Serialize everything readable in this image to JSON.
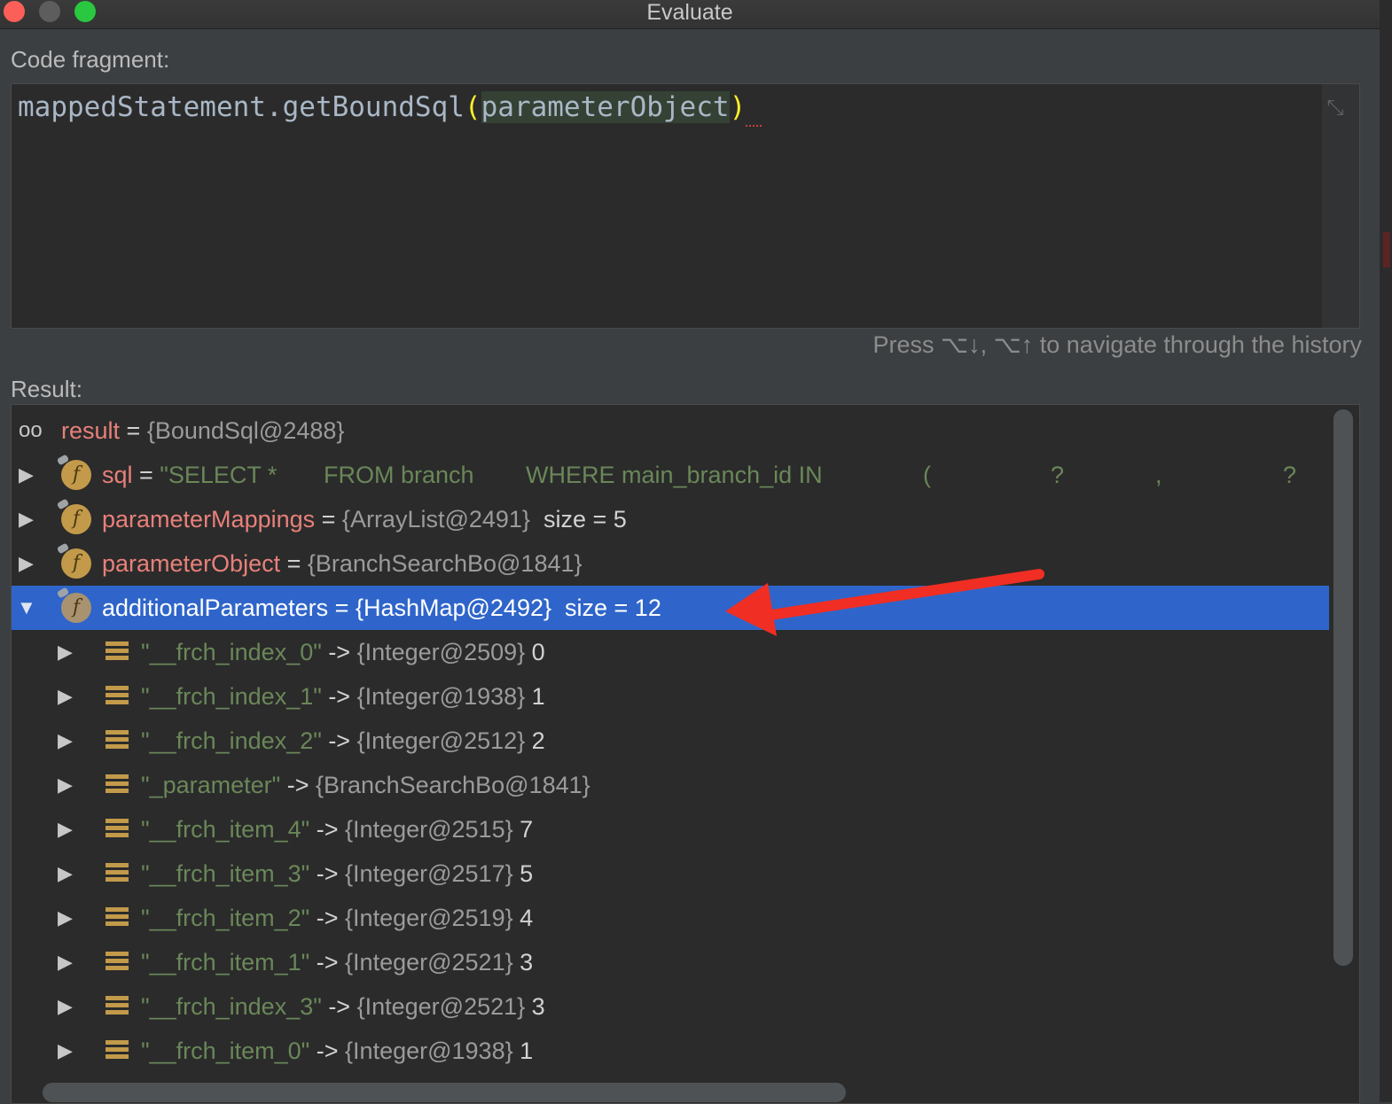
{
  "window": {
    "title": "Evaluate"
  },
  "code_fragment": {
    "label": "Code fragment:",
    "text_method": "mappedStatement.getBoundSql",
    "text_open": "(",
    "text_arg": "parameterObject",
    "text_close": ")"
  },
  "history_hint": "Press ⌥↓, ⌥↑ to navigate through the history",
  "result": {
    "label": "Result:",
    "root": {
      "name": "result",
      "eq": " = ",
      "value": "{BoundSql@2488}"
    },
    "fields": [
      {
        "name": "sql",
        "eq": " = ",
        "value": "\"SELECT *",
        "sql_parts": [
          "FROM branch",
          "WHERE main_branch_id IN",
          "(",
          "?",
          ",",
          "?"
        ]
      },
      {
        "name": "parameterMappings",
        "eq": " = ",
        "value": "{ArrayList@2491}",
        "extra": "size = 5"
      },
      {
        "name": "parameterObject",
        "eq": " = ",
        "value": "{BranchSearchBo@1841}"
      },
      {
        "name": "additionalParameters",
        "eq": " = ",
        "value": "{HashMap@2492}",
        "extra": "size = 12",
        "selected": true
      }
    ],
    "entries": [
      {
        "key": "\"__frch_index_0\"",
        "arrow": " -> ",
        "ref": "{Integer@2509}",
        "val": "0"
      },
      {
        "key": "\"__frch_index_1\"",
        "arrow": " -> ",
        "ref": "{Integer@1938}",
        "val": "1"
      },
      {
        "key": "\"__frch_index_2\"",
        "arrow": " -> ",
        "ref": "{Integer@2512}",
        "val": "2"
      },
      {
        "key": "\"_parameter\"",
        "arrow": " -> ",
        "ref": "{BranchSearchBo@1841}",
        "val": ""
      },
      {
        "key": "\"__frch_item_4\"",
        "arrow": " -> ",
        "ref": "{Integer@2515}",
        "val": "7"
      },
      {
        "key": "\"__frch_item_3\"",
        "arrow": " -> ",
        "ref": "{Integer@2517}",
        "val": "5"
      },
      {
        "key": "\"__frch_item_2\"",
        "arrow": " -> ",
        "ref": "{Integer@2519}",
        "val": "4"
      },
      {
        "key": "\"__frch_item_1\"",
        "arrow": " -> ",
        "ref": "{Integer@2521}",
        "val": "3"
      },
      {
        "key": "\"__frch_index_3\"",
        "arrow": " -> ",
        "ref": "{Integer@2521}",
        "val": "3"
      },
      {
        "key": "\"__frch_item_0\"",
        "arrow": " -> ",
        "ref": "{Integer@1938}",
        "val": "1"
      }
    ]
  },
  "icons": {
    "expand": "triangle-right-icon",
    "collapse": "triangle-down-icon",
    "field": "field-f-icon",
    "entry": "map-entry-icon",
    "watch": "glasses-icon"
  },
  "colors": {
    "selection": "#2f65ca",
    "field_name": "#e8807a",
    "string": "#6a8759",
    "annotation_arrow": "#f02e23"
  }
}
